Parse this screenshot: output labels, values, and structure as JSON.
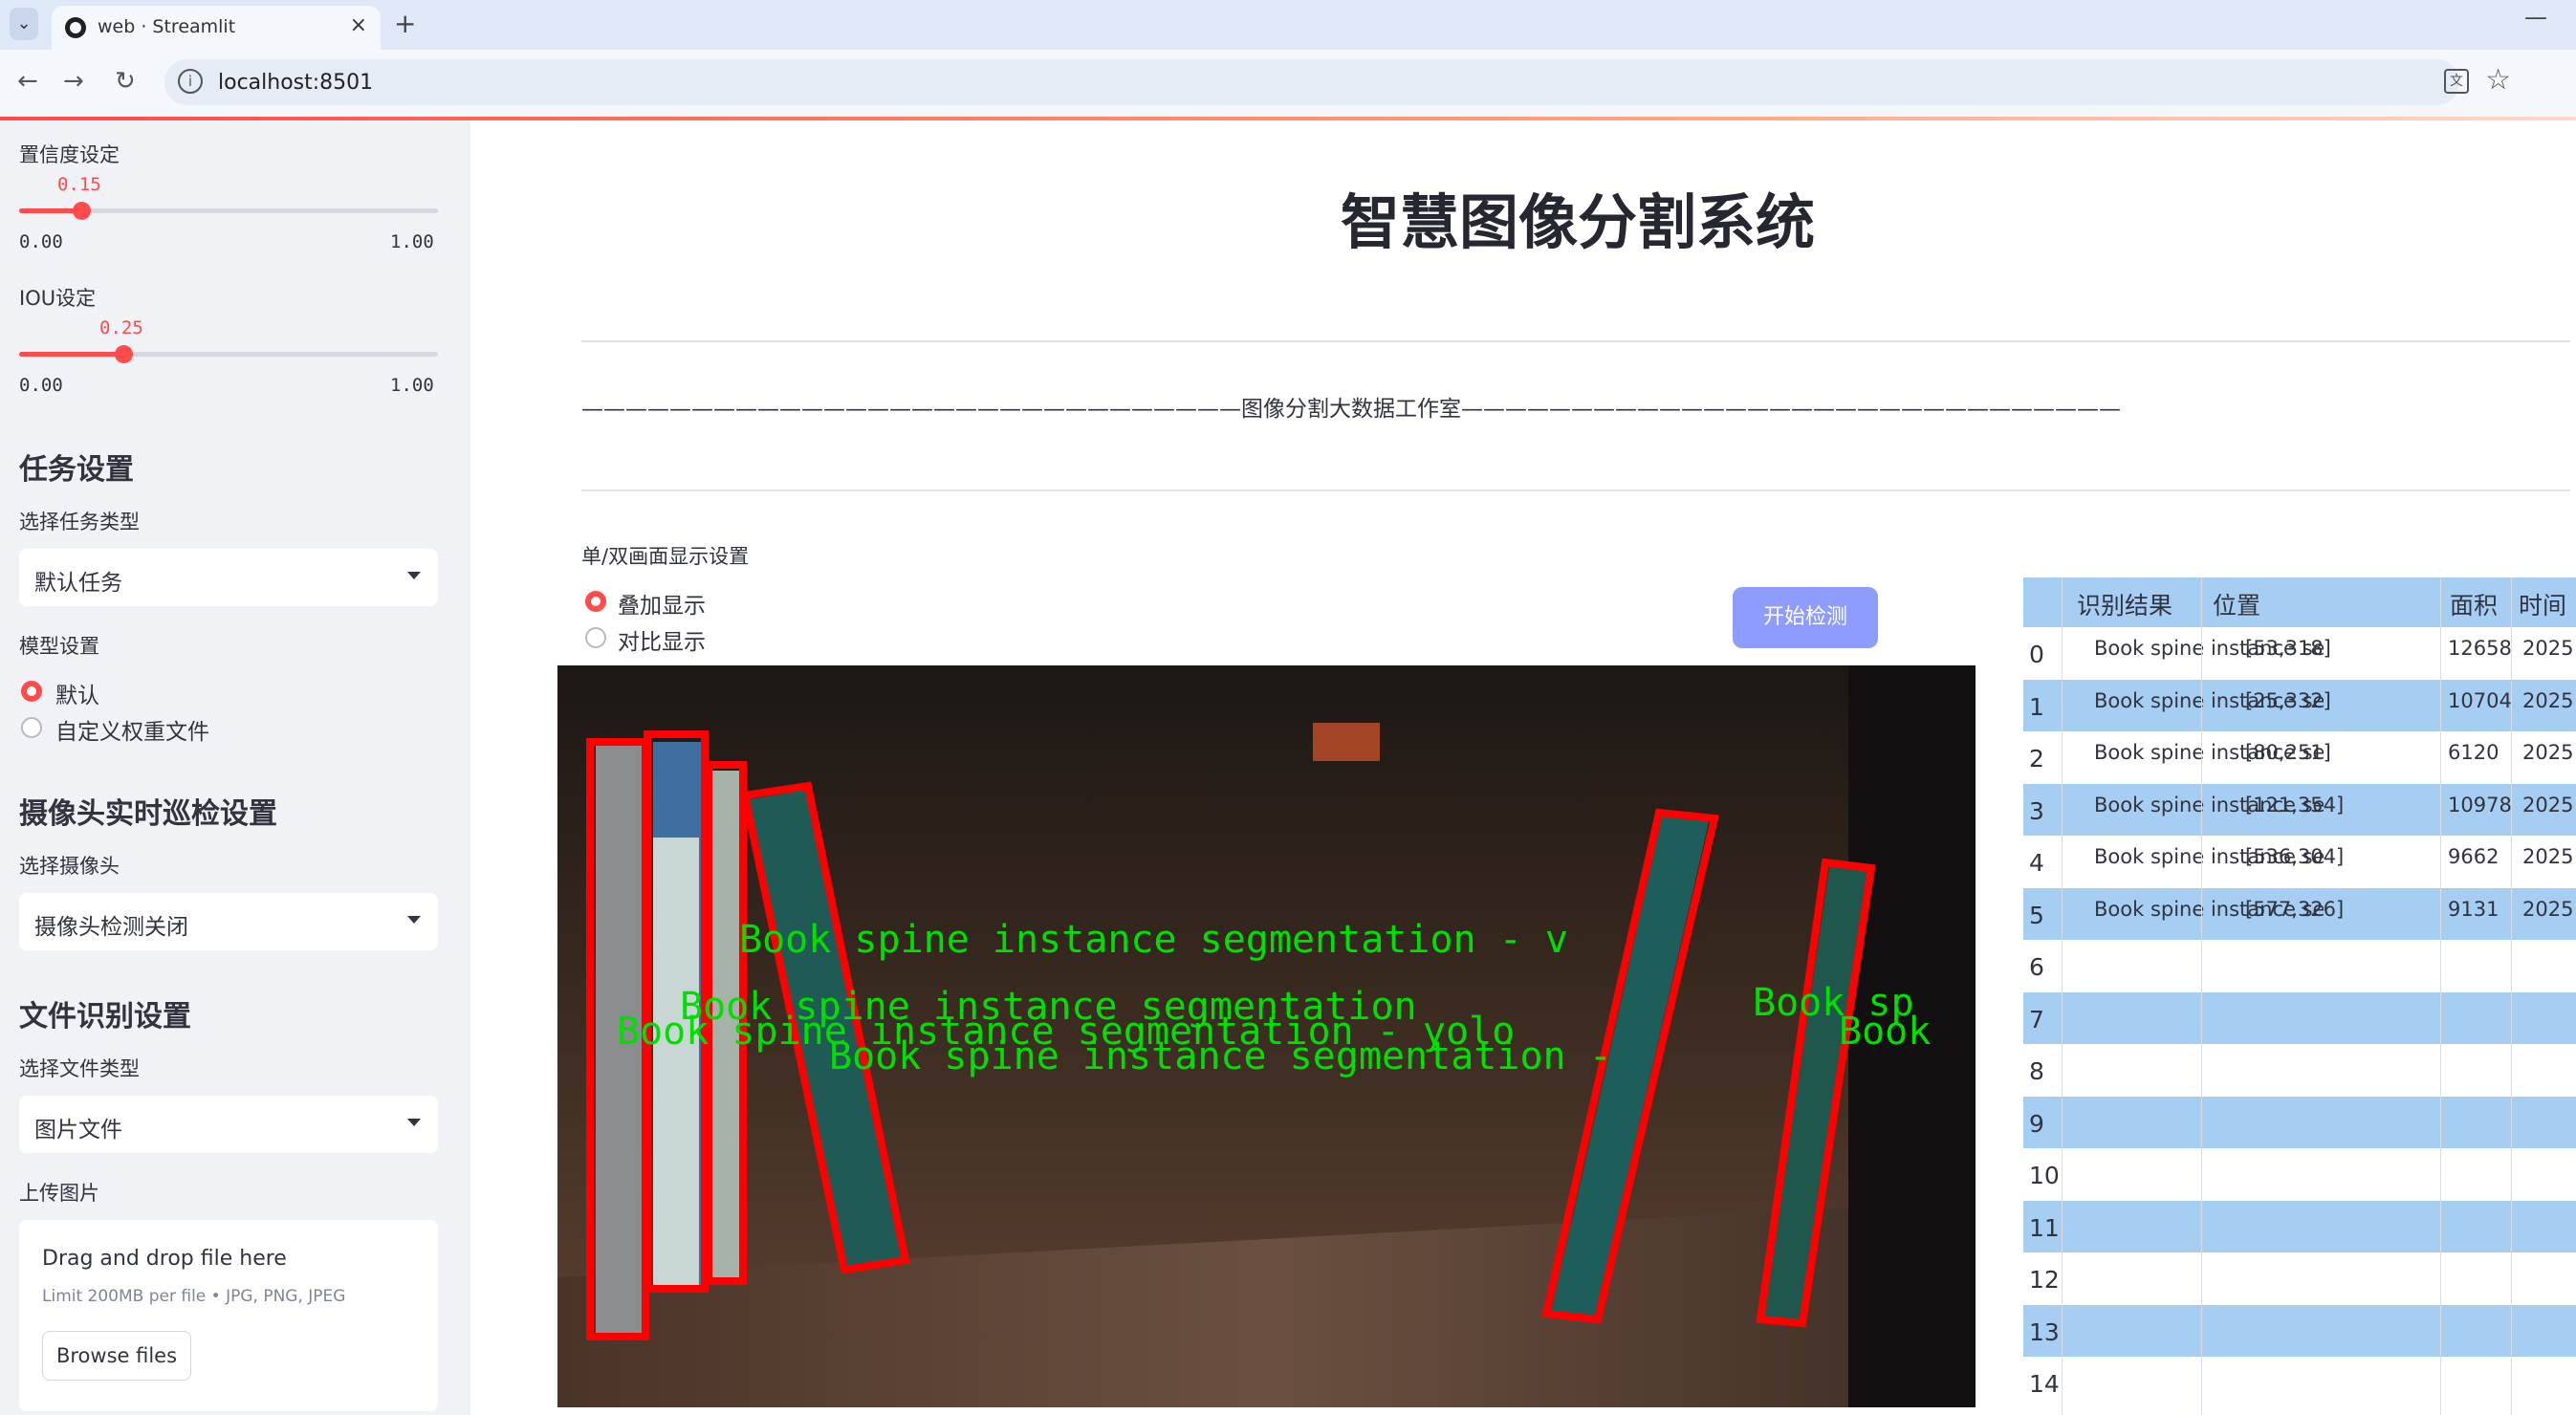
{
  "browser": {
    "tab_title": "web · Streamlit",
    "url": "localhost:8501"
  },
  "sidebar": {
    "confidence": {
      "label": "置信度设定",
      "value": "0.15",
      "min": "0.00",
      "max": "1.00",
      "fraction": 0.15
    },
    "iou": {
      "label": "IOU设定",
      "value": "0.25",
      "min": "0.00",
      "max": "1.00",
      "fraction": 0.25
    },
    "task_header": "任务设置",
    "task_type_label": "选择任务类型",
    "task_type_value": "默认任务",
    "model_label": "模型设置",
    "model_options": [
      "默认",
      "自定义权重文件"
    ],
    "model_selected": 0,
    "camera_header": "摄像头实时巡检设置",
    "camera_label": "选择摄像头",
    "camera_value": "摄像头检测关闭",
    "file_header": "文件识别设置",
    "file_type_label": "选择文件类型",
    "file_type_value": "图片文件",
    "upload_label": "上传图片",
    "upload_title": "Drag and drop file here",
    "upload_limit": "Limit 200MB per file • JPG, PNG, JPEG",
    "browse_label": "Browse files"
  },
  "main": {
    "title": "智慧图像分割系统",
    "divider_text": "——————————————————————————————图像分割大数据工作室——————————————————————————————",
    "display_label": "单/双画面显示设置",
    "display_options": [
      "叠加显示",
      "对比显示"
    ],
    "display_selected": 0,
    "start_button": "开始检测"
  },
  "scene": {
    "overlay_lines": [
      "Book spine instance segmentation - v",
      "Book spine instance segmentation",
      "Book spine instance segmentation - yolo",
      "Book spine instance segmentation -",
      "Book sp",
      "Book"
    ],
    "box_color": "#ff0000",
    "text_color": "#00e000"
  },
  "table": {
    "columns": [
      "识别结果",
      "位置",
      "面积",
      "时间"
    ],
    "rows": [
      {
        "index": "0",
        "label": "Book spine instance segmentation",
        "pos": "[53,318]",
        "area": "12658",
        "time": "2025"
      },
      {
        "index": "1",
        "label": "Book spine instance segmentation",
        "pos": "[25,332]",
        "area": "10704",
        "time": "2025"
      },
      {
        "index": "2",
        "label": "Book spine instance segmentation",
        "pos": "[80,251]",
        "area": "6120",
        "time": "2025"
      },
      {
        "index": "3",
        "label": "Book spine instance segmentation",
        "pos": "[121,354]",
        "area": "10978",
        "time": "2025"
      },
      {
        "index": "4",
        "label": "Book spine instance segmentation",
        "pos": "[536,304]",
        "area": "9662",
        "time": "2025"
      },
      {
        "index": "5",
        "label": "Book spine instance segmentation",
        "pos": "[577,326]",
        "area": "9131",
        "time": "2025"
      },
      {
        "index": "6",
        "label": "",
        "pos": "",
        "area": "",
        "time": ""
      },
      {
        "index": "7",
        "label": "",
        "pos": "",
        "area": "",
        "time": ""
      },
      {
        "index": "8",
        "label": "",
        "pos": "",
        "area": "",
        "time": ""
      },
      {
        "index": "9",
        "label": "",
        "pos": "",
        "area": "",
        "time": ""
      },
      {
        "index": "10",
        "label": "",
        "pos": "",
        "area": "",
        "time": ""
      },
      {
        "index": "11",
        "label": "",
        "pos": "",
        "area": "",
        "time": ""
      },
      {
        "index": "12",
        "label": "",
        "pos": "",
        "area": "",
        "time": ""
      },
      {
        "index": "13",
        "label": "",
        "pos": "",
        "area": "",
        "time": ""
      },
      {
        "index": "14",
        "label": "",
        "pos": "",
        "area": "",
        "time": ""
      }
    ]
  },
  "colors": {
    "accent": "#ff4b4b",
    "sidebar_bg": "#f0f2f6",
    "table_stripe": "#a6cdf2",
    "start_button": "#8f9cff"
  }
}
